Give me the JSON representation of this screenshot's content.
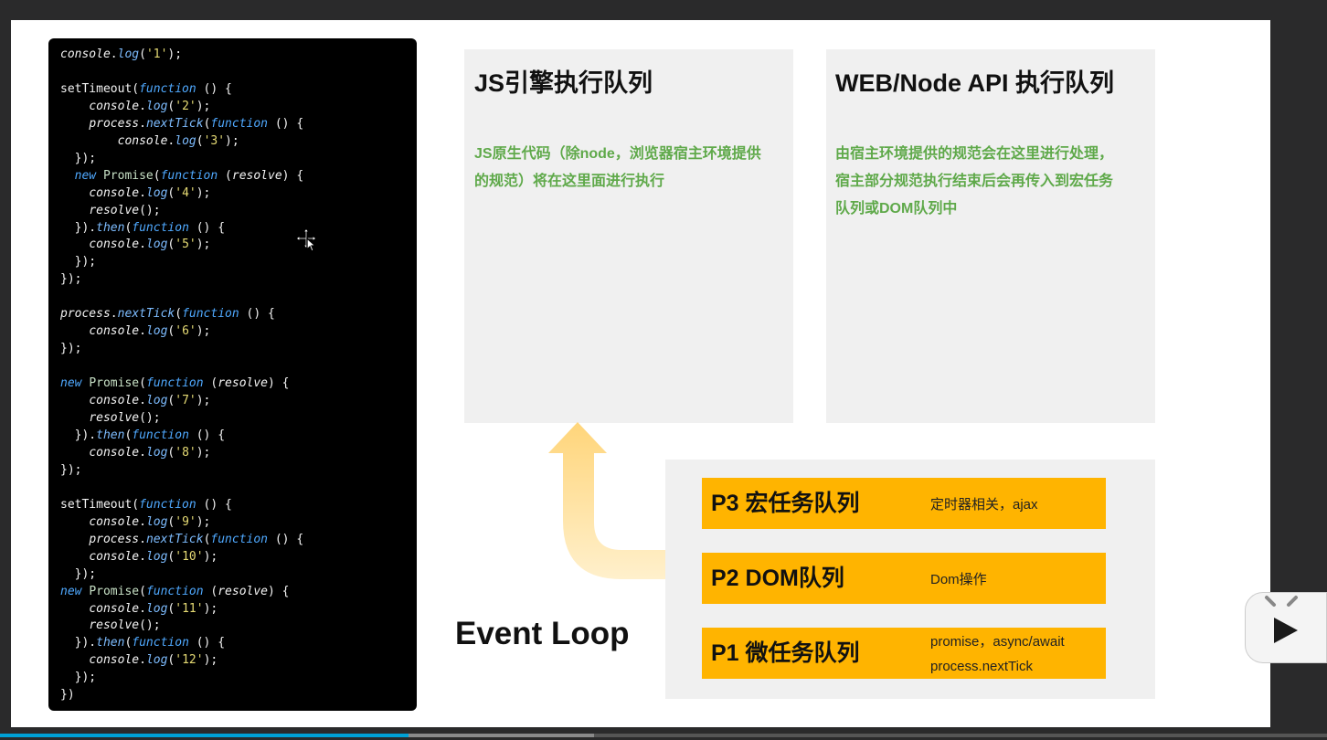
{
  "code_lines": [
    "console.log('1');",
    "",
    "setTimeout(function () {",
    "    console.log('2');",
    "    process.nextTick(function () {",
    "        console.log('3');",
    "  });",
    "  new Promise(function (resolve) {",
    "    console.log('4');",
    "    resolve();",
    "  }).then(function () {",
    "    console.log('5');",
    "  });",
    "});",
    "",
    "process.nextTick(function () {",
    "    console.log('6');",
    "});",
    "",
    "new Promise(function (resolve) {",
    "    console.log('7');",
    "    resolve();",
    "  }).then(function () {",
    "    console.log('8');",
    "});",
    "",
    "setTimeout(function () {",
    "    console.log('9');",
    "    process.nextTick(function () {",
    "    console.log('10');",
    "  });",
    "new Promise(function (resolve) {",
    "    console.log('11');",
    "    resolve();",
    "  }).then(function () {",
    "    console.log('12');",
    "  });",
    "})"
  ],
  "js_engine_panel": {
    "title": "JS引擎执行队列",
    "desc_line1": "JS原生代码（除node，浏览器宿主环境提供",
    "desc_line2": "的规范）将在这里面进行执行"
  },
  "web_api_panel": {
    "title": "WEB/Node API 执行队列",
    "desc_line1": "由宿主环境提供的规范会在这里进行处理，",
    "desc_line2": "宿主部分规范执行结束后会再传入到宏任务",
    "desc_line3": "队列或DOM队列中"
  },
  "queues": {
    "p3": {
      "title": "P3 宏任务队列",
      "desc": "定时器相关，ajax"
    },
    "p2": {
      "title": "P2 DOM队列",
      "desc": "Dom操作"
    },
    "p1": {
      "title": "P1 微任务队列",
      "desc_line1": "promise，async/await",
      "desc_line2": "process.nextTick"
    }
  },
  "event_loop_label": "Event Loop",
  "video": {
    "progress_fraction": 0.308
  },
  "colors": {
    "queue_bar": "#ffb400",
    "desc_green": "#5fa94a",
    "panel_bg": "#f0f0f0",
    "arrow": "#ffd57a"
  }
}
